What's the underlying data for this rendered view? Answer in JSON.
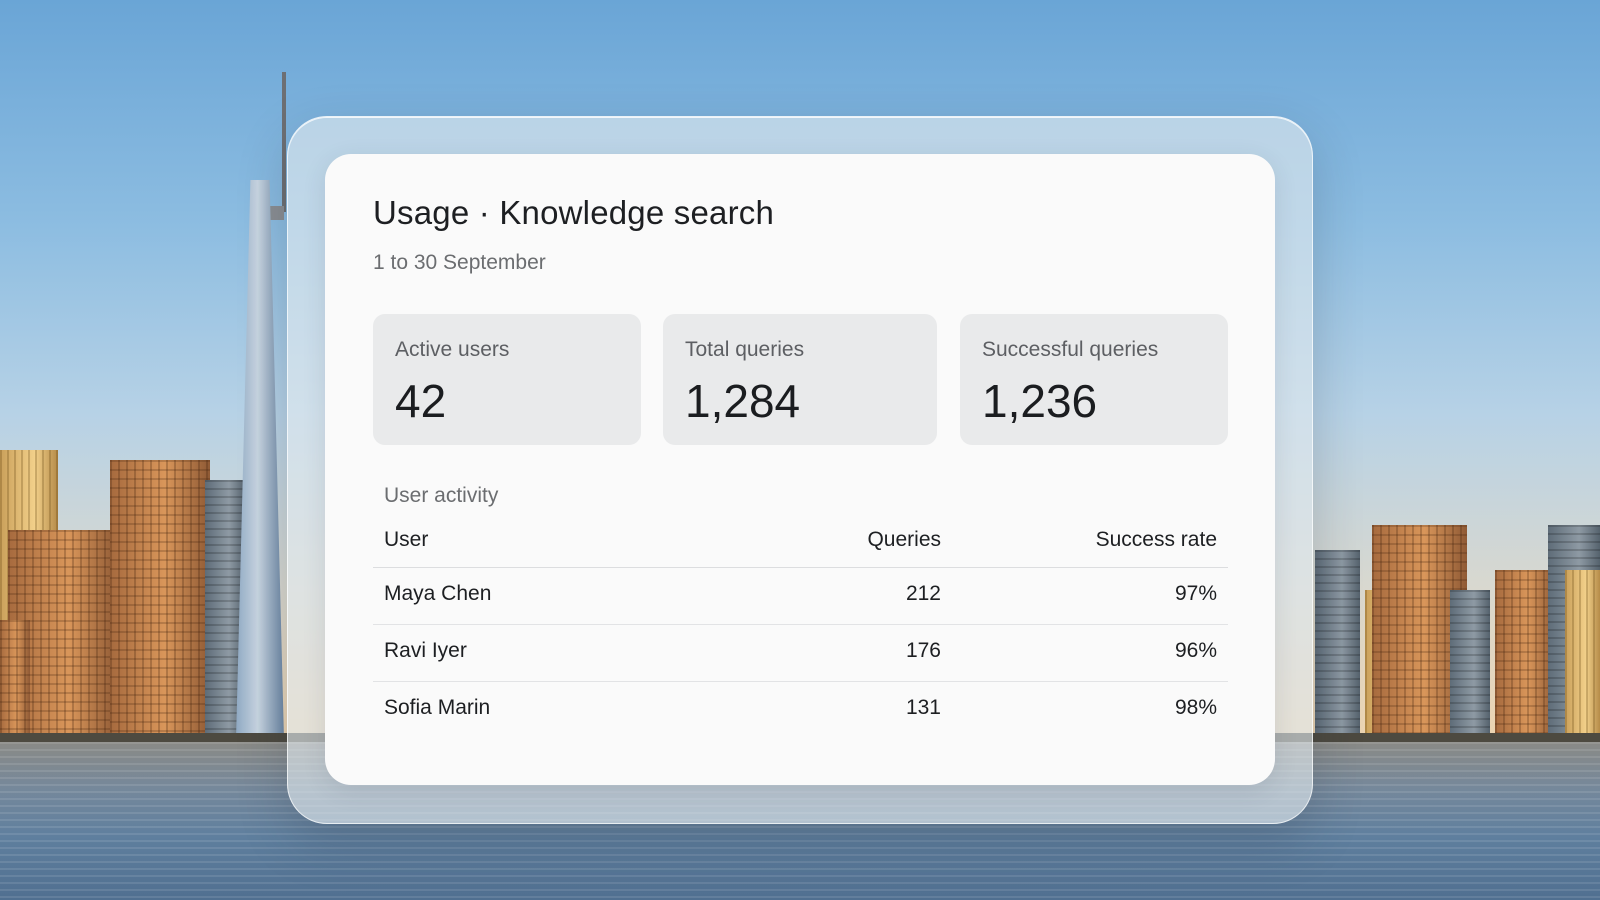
{
  "card": {
    "title": "Usage · Knowledge search",
    "date_range": "1 to 30 September"
  },
  "stats": [
    {
      "label": "Active users",
      "value": "42"
    },
    {
      "label": "Total queries",
      "value": "1,284"
    },
    {
      "label": "Successful queries",
      "value": "1,236"
    }
  ],
  "activity": {
    "section_title": "User activity",
    "columns": [
      "User",
      "Queries",
      "Success rate"
    ],
    "rows": [
      {
        "user": "Maya Chen",
        "queries": "212",
        "success_rate": "97%"
      },
      {
        "user": "Ravi Iyer",
        "queries": "176",
        "success_rate": "96%"
      },
      {
        "user": "Sofia Marin",
        "queries": "131",
        "success_rate": "98%"
      }
    ]
  }
}
